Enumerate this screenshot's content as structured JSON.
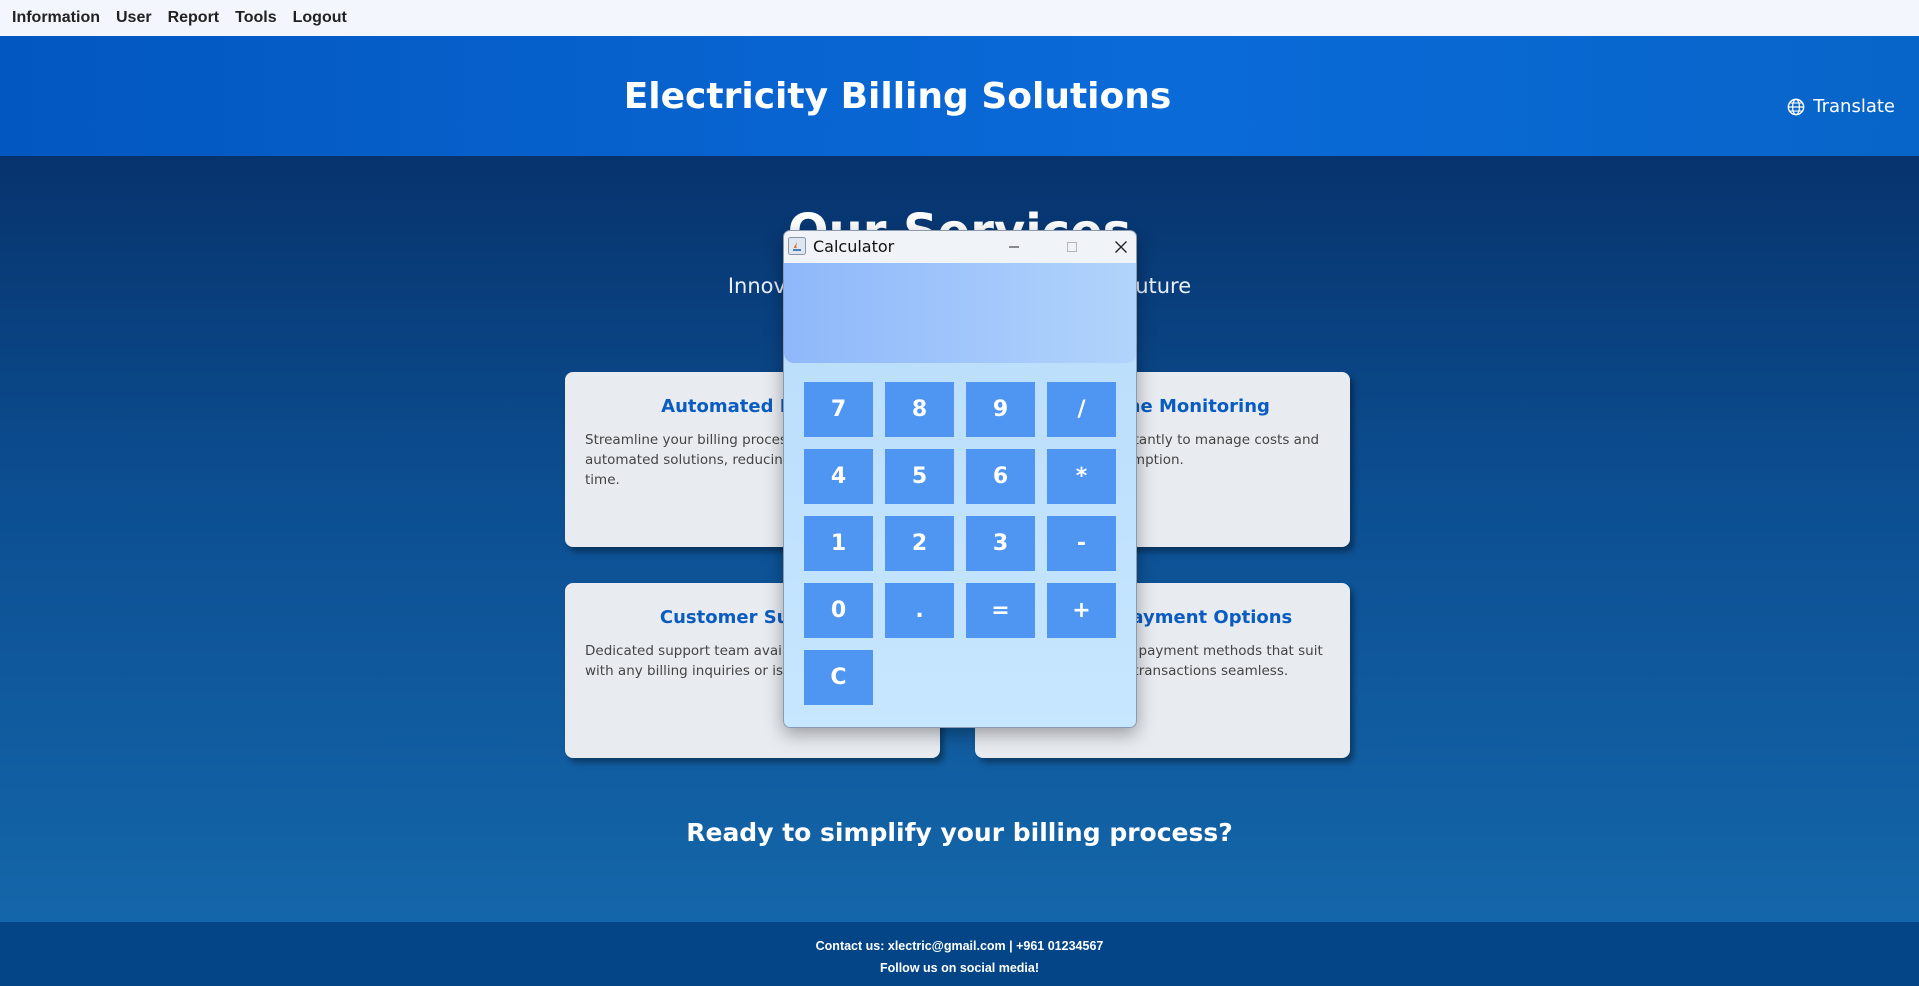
{
  "menu": [
    "Information",
    "User",
    "Report",
    "Tools",
    "Logout"
  ],
  "header": {
    "title": "Electricity Billing Solutions",
    "translate_label": "Translate"
  },
  "services": {
    "title": "Our Services",
    "subtitle": "Innovative solutions for a sustainable future",
    "cards": [
      {
        "title": "Automated Billing",
        "desc": "Streamline your billing processes with our automated solutions, reducing errors and saving time."
      },
      {
        "title": "Real-time Monitoring",
        "desc": "Track your usage instantly to manage costs and optimize your consumption."
      },
      {
        "title": "Customer Support",
        "desc": "Dedicated support team available to assist you with any billing inquiries or issues."
      },
      {
        "title": "Flexible Payment Options",
        "desc": "Choose from various payment methods that suit your needs, making transactions seamless."
      }
    ]
  },
  "cta": "Ready to simplify your billing process?",
  "footer": {
    "contact": "Contact us: xlectric@gmail.com | +961 01234567",
    "follow": "Follow us on social media!"
  },
  "calculator": {
    "title": "Calculator",
    "display_value": "",
    "keys": [
      "7",
      "8",
      "9",
      "/",
      "4",
      "5",
      "6",
      "*",
      "1",
      "2",
      "3",
      "-",
      "0",
      ".",
      "=",
      "+",
      "C"
    ]
  }
}
